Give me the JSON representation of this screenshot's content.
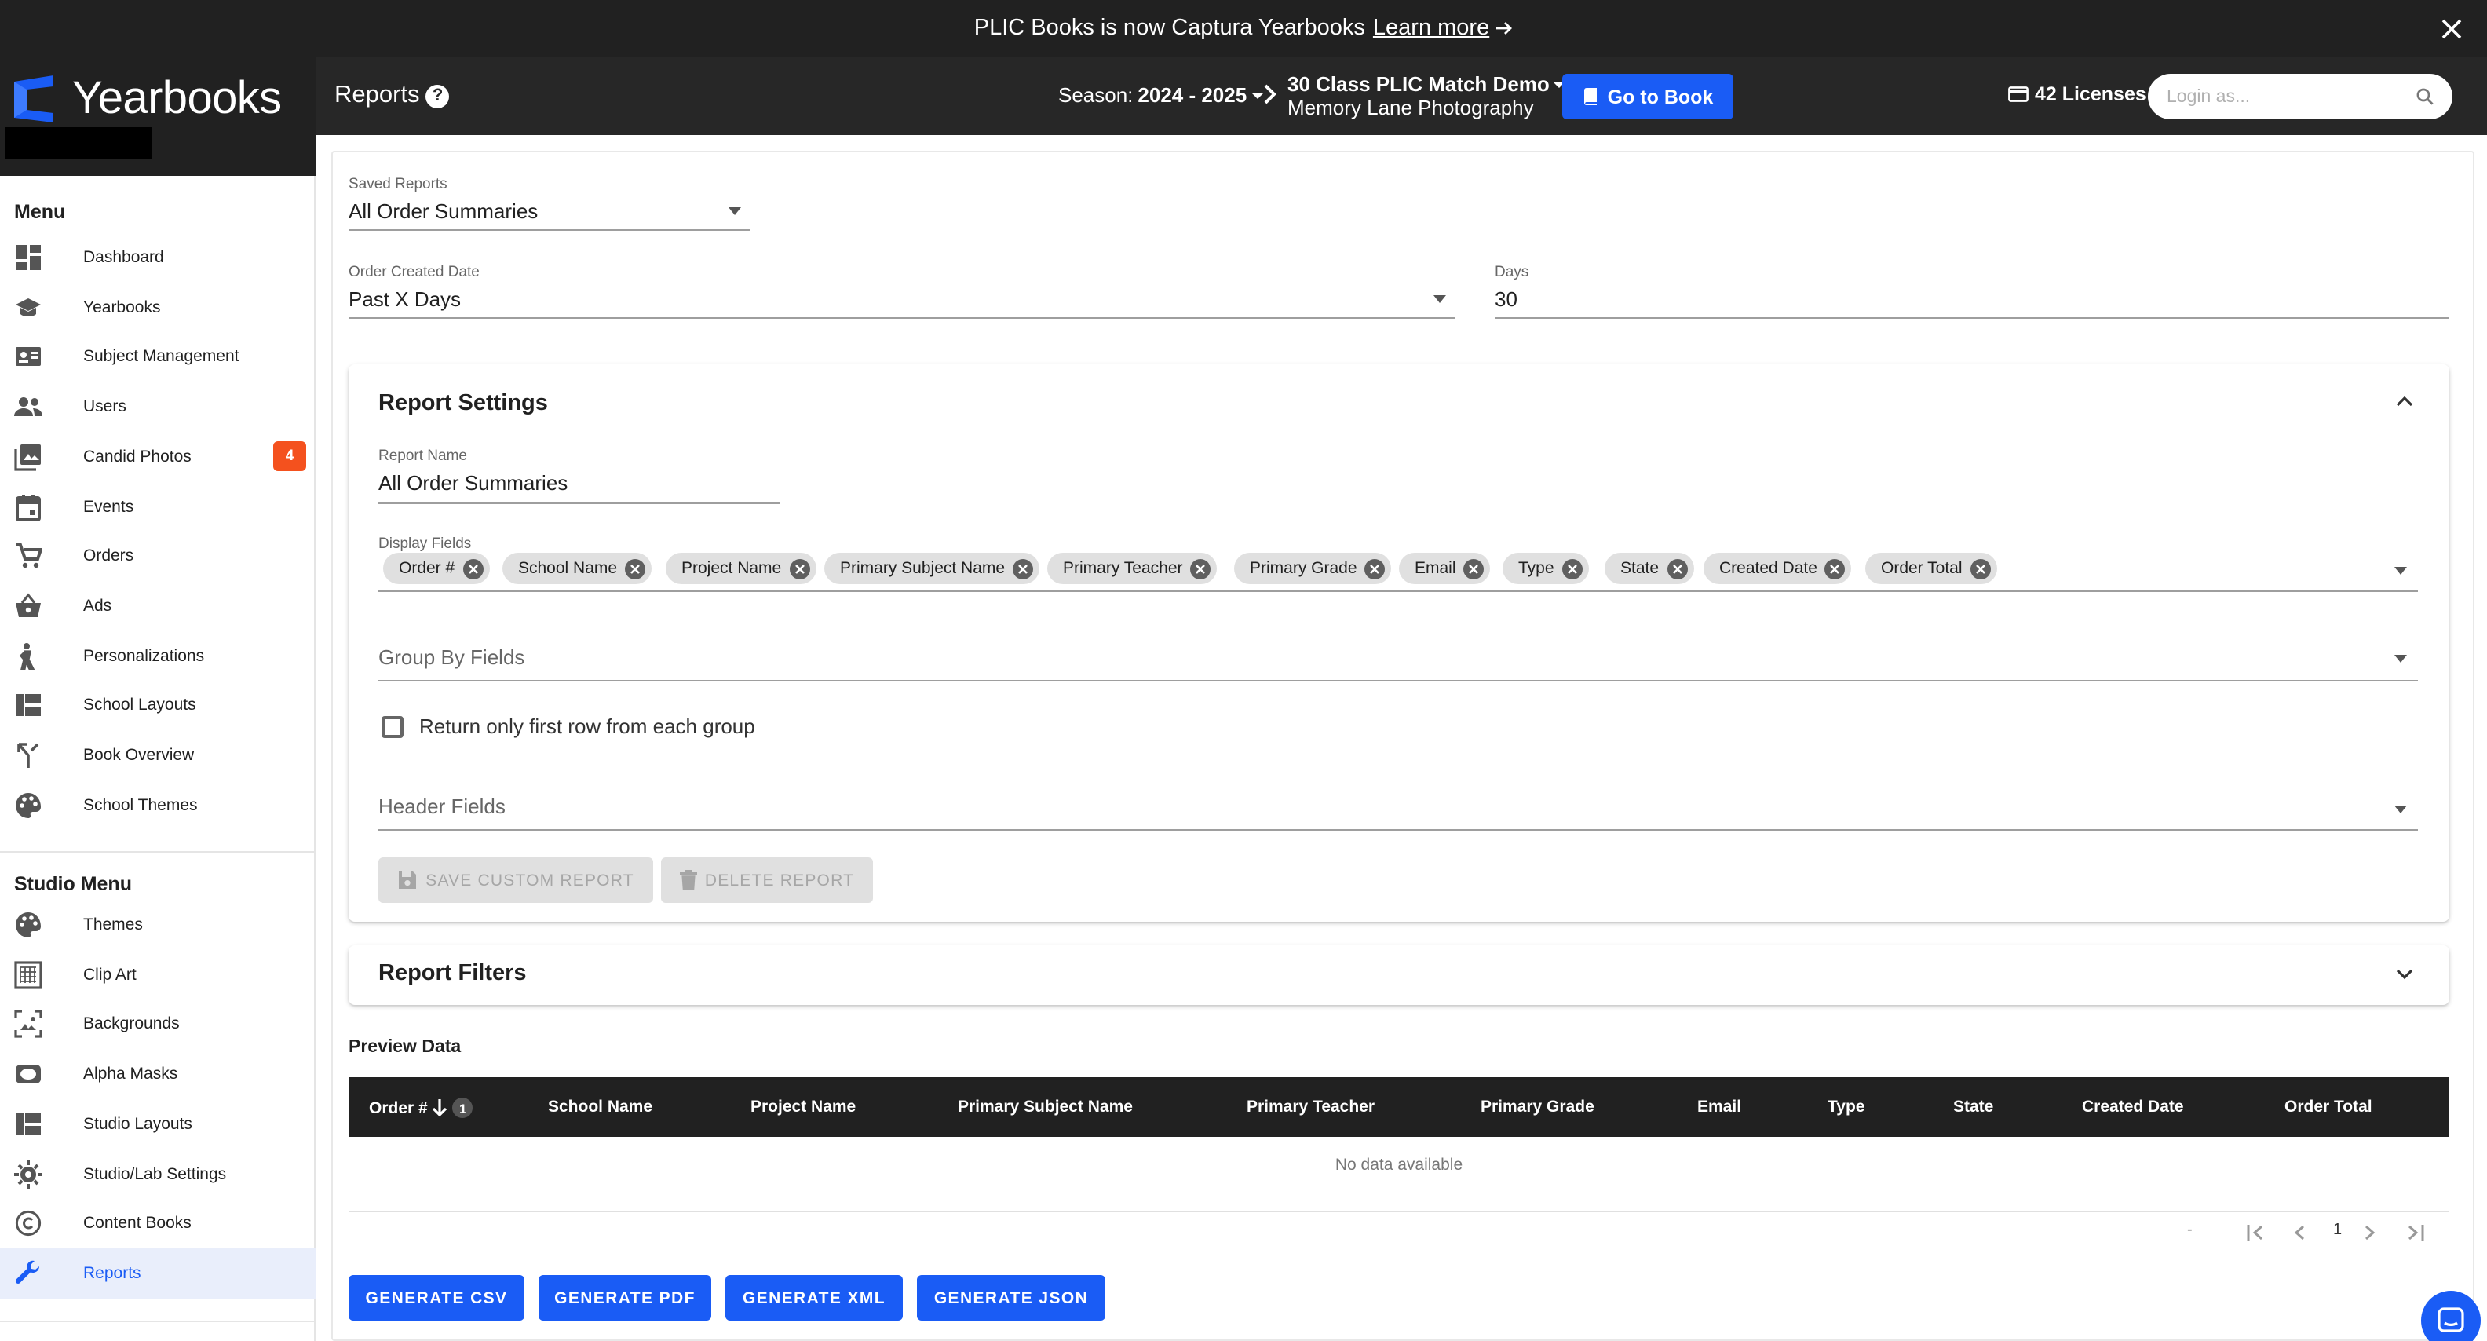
{
  "banner": {
    "text": "PLIC Books is now Captura Yearbooks",
    "link": "Learn more"
  },
  "logo": {
    "text": "Yearbooks"
  },
  "header": {
    "title": "Reports",
    "season_label": "Season:",
    "season_value": "2024 - 2025",
    "project_name": "30 Class PLIC Match Demo",
    "project_studio": "Memory Lane Photography",
    "go_to_book": "Go to Book",
    "licenses": "42 Licenses",
    "login_placeholder": "Login as..."
  },
  "sidebar": {
    "menu_title": "Menu",
    "menu_items": [
      {
        "label": "Dashboard",
        "icon": "dashboard-icon"
      },
      {
        "label": "Yearbooks",
        "icon": "graduation-cap-icon"
      },
      {
        "label": "Subject Management",
        "icon": "id-card-icon"
      },
      {
        "label": "Users",
        "icon": "users-icon"
      },
      {
        "label": "Candid Photos",
        "icon": "photo-library-icon",
        "badge": "4"
      },
      {
        "label": "Events",
        "icon": "calendar-icon"
      },
      {
        "label": "Orders",
        "icon": "cart-icon"
      },
      {
        "label": "Ads",
        "icon": "basket-icon"
      },
      {
        "label": "Personalizations",
        "icon": "person-icon"
      },
      {
        "label": "School Layouts",
        "icon": "layout-icon"
      },
      {
        "label": "Book Overview",
        "icon": "merge-icon"
      },
      {
        "label": "School Themes",
        "icon": "palette-icon"
      }
    ],
    "studio_title": "Studio Menu",
    "studio_items": [
      {
        "label": "Themes",
        "icon": "palette-icon"
      },
      {
        "label": "Clip Art",
        "icon": "clip-art-icon"
      },
      {
        "label": "Backgrounds",
        "icon": "background-icon"
      },
      {
        "label": "Alpha Masks",
        "icon": "mask-icon"
      },
      {
        "label": "Studio Layouts",
        "icon": "layout-icon"
      },
      {
        "label": "Studio/Lab Settings",
        "icon": "gear-icon"
      },
      {
        "label": "Content Books",
        "icon": "copyright-icon"
      },
      {
        "label": "Reports",
        "icon": "wrench-icon",
        "active": true
      }
    ]
  },
  "form": {
    "saved_reports_label": "Saved Reports",
    "saved_reports_value": "All Order Summaries",
    "order_created_label": "Order Created Date",
    "order_created_value": "Past X Days",
    "days_label": "Days",
    "days_value": "30"
  },
  "report_settings": {
    "title": "Report Settings",
    "report_name_label": "Report Name",
    "report_name_value": "All Order Summaries",
    "display_fields_label": "Display Fields",
    "display_fields": [
      "Order #",
      "School Name",
      "Project Name",
      "Primary Subject Name",
      "Primary Teacher",
      "Primary Grade",
      "Email",
      "Type",
      "State",
      "Created Date",
      "Order Total"
    ],
    "group_by_label": "Group By Fields",
    "first_row_label": "Return only first row from each group",
    "first_row_checked": false,
    "header_fields_label": "Header Fields",
    "save_button": "SAVE CUSTOM REPORT",
    "delete_button": "DELETE REPORT"
  },
  "report_filters": {
    "title": "Report Filters"
  },
  "preview": {
    "title": "Preview Data",
    "columns": [
      "Order #",
      "School Name",
      "Project Name",
      "Primary Subject Name",
      "Primary Teacher",
      "Primary Grade",
      "Email",
      "Type",
      "State",
      "Created Date",
      "Order Total"
    ],
    "sort_index": "1",
    "no_data": "No data available",
    "pagination_range": "-",
    "page": "1"
  },
  "actions": {
    "csv": "GENERATE CSV",
    "pdf": "GENERATE PDF",
    "xml": "GENERATE XML",
    "json": "GENERATE JSON"
  },
  "colors": {
    "accent": "#1a5cf5",
    "header": "#272727",
    "banner": "#212121",
    "badge": "#f4511e"
  }
}
